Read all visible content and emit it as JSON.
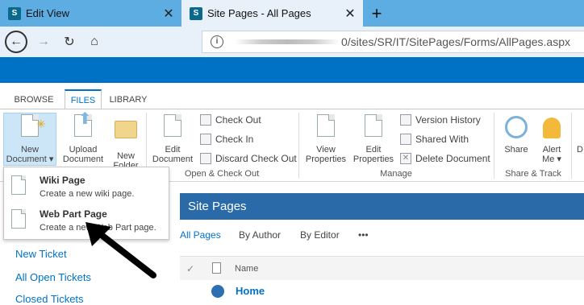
{
  "browser": {
    "tabs": [
      {
        "title": "Edit View",
        "icon": "S"
      },
      {
        "title": "Site Pages - All Pages",
        "icon": "S"
      }
    ],
    "new_tab": "+",
    "url_tail": "0/sites/SR/IT/SitePages/Forms/AllPages.aspx",
    "info_icon": "i"
  },
  "ribbon": {
    "tabs": [
      "BROWSE",
      "FILES",
      "LIBRARY"
    ],
    "new_document": {
      "line1": "New",
      "line2": "Document ▾"
    },
    "upload_document": {
      "line1": "Upload",
      "line2": "Document"
    },
    "new_folder": {
      "line1": "New",
      "line2": "Folder"
    },
    "edit_document": {
      "line1": "Edit",
      "line2": "Document"
    },
    "check_out": "Check Out",
    "check_in": "Check In",
    "discard_check_out": "Discard Check Out",
    "group_open_check_out": "Open & Check Out",
    "view_properties": {
      "line1": "View",
      "line2": "Properties"
    },
    "edit_properties": {
      "line1": "Edit",
      "line2": "Properties"
    },
    "version_history": "Version History",
    "shared_with": "Shared With",
    "delete_document": "Delete Document",
    "group_manage": "Manage",
    "share": "Share",
    "alert_me": {
      "line1": "Alert",
      "line2": "Me ▾"
    },
    "group_share_track": "Share & Track",
    "cut_off_label": "D"
  },
  "dropdown": [
    {
      "title": "Wiki Page",
      "desc": "Create a new wiki page."
    },
    {
      "title": "Web Part Page",
      "desc": "Create a new Web Part page."
    }
  ],
  "leftnav": [
    "New Ticket",
    "All Open Tickets",
    "Closed Tickets"
  ],
  "content": {
    "header": "Site Pages",
    "views": [
      "All Pages",
      "By Author",
      "By Editor",
      "•••"
    ],
    "column_name": "Name",
    "rows": [
      "Home"
    ]
  },
  "colors": {
    "suite_bar": "#0072c6",
    "site_pages_header": "#2a6aa8",
    "tab_strip": "#5dade2"
  }
}
